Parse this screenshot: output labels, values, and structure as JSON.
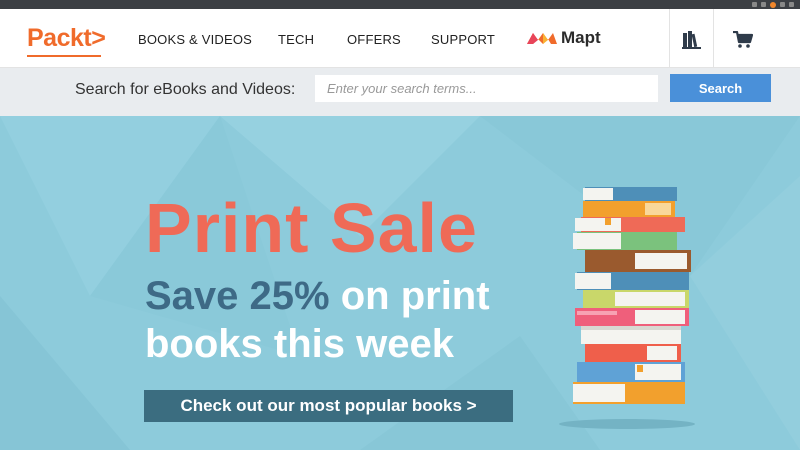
{
  "brand": {
    "logo_text": "Packt>",
    "accent_color": "#f06b2b"
  },
  "nav": {
    "items": [
      {
        "label": "BOOKS & VIDEOS"
      },
      {
        "label": "TECH"
      },
      {
        "label": "OFFERS"
      },
      {
        "label": "SUPPORT"
      }
    ],
    "mapt_label": "Mapt",
    "icons": [
      "library-icon",
      "cart-icon"
    ]
  },
  "search": {
    "label": "Search for eBooks and Videos:",
    "placeholder": "Enter your search terms...",
    "value": "",
    "button_label": "Search",
    "button_color": "#4a90d9"
  },
  "banner": {
    "headline": "Print Sale",
    "sub_part1": "Save 25%",
    "sub_part2": " on print",
    "sub_line2": "books this week",
    "cta_label": "Check out our most popular books >",
    "background_color": "#8dcbdb",
    "headline_color": "#ef6a57"
  }
}
